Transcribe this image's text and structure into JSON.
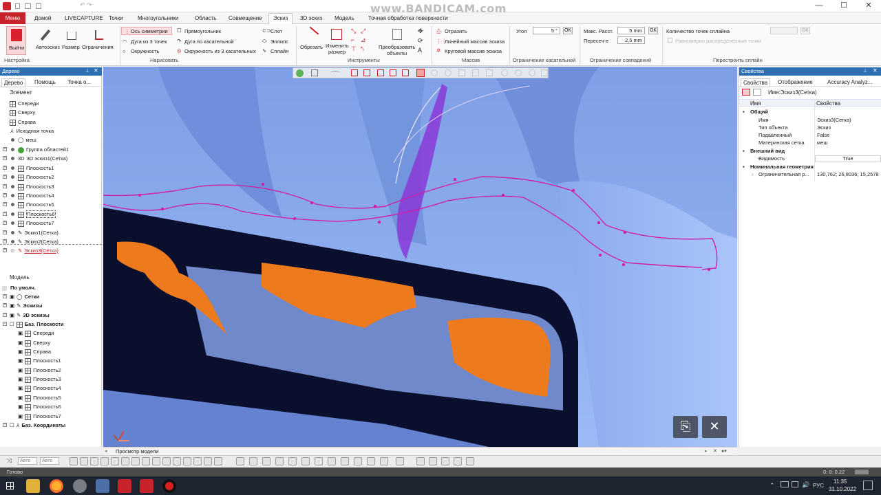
{
  "titlebar": {
    "minimize": "—",
    "maximize": "☐",
    "close": "✕"
  },
  "watermark": "www.BANDICAM.com",
  "menu": {
    "main_button": "Меню",
    "tabs": [
      "Домой",
      "LIVECAPTURE",
      "Точки",
      "Многоугольники",
      "Область",
      "Совмещение",
      "Эскиз",
      "3D эскиз",
      "Модель",
      "Точная обработка поверхности"
    ],
    "active_tab": "Эскиз"
  },
  "ribbon": {
    "exit_label": "Выйти",
    "autosketch": "Автоэскиз",
    "size": "Размер",
    "constraints": "Ограничения",
    "symmetry_axis": "Ось симметрии",
    "rectangle": "Прямоугольник",
    "slot": "Слот",
    "arc3": "Дуга из 3 точек",
    "arc_tangent": "Дуга по касательной",
    "ellipse": "Эллипс",
    "circle": "Окружность",
    "circle3tangent": "Окружность из 3 касательных",
    "spline": "Сплайн",
    "trim": "Обрезать",
    "resize1": "Изменить",
    "resize2": "размер",
    "transform1": "Преобразовать",
    "transform2": "объекты",
    "mirror": "Отразить",
    "linear_array": "Линейный массив эскиза",
    "circular_array": "Круговой массив эскиза",
    "angle_label": "Угол",
    "angle_value": "5 °",
    "ok": "OK",
    "max_dist_label": "Макс. Расст.",
    "max_dist_value": "5 mm",
    "intersect_label": "Пересеч-е",
    "intersect_value": "2,5 mm",
    "spline_points_label": "Количество точек сплайна",
    "evenly_label": "Равномерно распределенные точки",
    "groups": [
      "Настройка",
      "Нарисовать",
      "Инструменты",
      "Массив",
      "Ограничение касательной",
      "Ограничение совпадений",
      "Перестроить сплайн"
    ]
  },
  "tree_panel": {
    "title": "Дерево",
    "tabs": [
      "Дерево",
      "Помощь",
      "Точка о..."
    ],
    "element_header": "Элемент",
    "items": [
      "Спереди",
      "Сверху",
      "Справа",
      "Исходная точка",
      "меш",
      "Группа областей1",
      "3D эскиз1(Сетка)",
      "Плоскость1",
      "Плоскость2",
      "Плоскость3",
      "Плоскость4",
      "Плоскость5",
      "Плоскость6",
      "Плоскость7",
      "Эскиз1(Сетка)",
      "Эскиз2(Сетка)",
      "Эскиз3(Сетка)"
    ],
    "model_header": "Модель",
    "model_items": [
      "По умолч.",
      "Сетки",
      "Эскизы",
      "3D эскизы",
      "Баз. Плоскости",
      "Спереди",
      "Сверху",
      "Справа",
      "Плоскость1",
      "Плоскость2",
      "Плоскость3",
      "Плоскость4",
      "Плоскость5",
      "Плоскость6",
      "Плоскость7",
      "Баз. Координаты"
    ]
  },
  "properties": {
    "title": "Свойства",
    "tabs": [
      "Свойства",
      "Отображение",
      "Accuracy Analyz..."
    ],
    "name_line": "Имя:Эскиз3(Сетка)",
    "col_name": "Имя",
    "col_props": "Свойства",
    "rows": [
      {
        "name": "Общий",
        "value": "",
        "group": true
      },
      {
        "name": "Имя",
        "value": "Эскиз3(Сетка)",
        "group": false
      },
      {
        "name": "Тип объекта",
        "value": "Эскиз",
        "group": false
      },
      {
        "name": "Подавленный",
        "value": "False",
        "group": false
      },
      {
        "name": "Материнская сетка",
        "value": "меш",
        "group": false
      },
      {
        "name": "Внешний вид",
        "value": "",
        "group": true
      },
      {
        "name": "Видимость",
        "value": "True",
        "group": false
      },
      {
        "name": "Номинальная геометрия",
        "value": "",
        "group": true
      },
      {
        "name": "Ограничительная р...",
        "value": "130,762; 26,8036; 15,2578",
        "group": false
      }
    ]
  },
  "viewport": {
    "view_tab": "Просмотр модели"
  },
  "bottom": {
    "auto1": "Авто",
    "auto2": "Авто"
  },
  "status": {
    "text": "Готово",
    "timer": "0: 0: 0.22"
  },
  "taskbar": {
    "time": "11:35",
    "date": "31.10.2022",
    "lang": "РУС"
  },
  "colors": {
    "accent": "#c8232b",
    "mesh": "#8fb1f3",
    "sketch": "#d21ea5",
    "orange": "#ee7a1e",
    "selection": "#8a3ad8"
  }
}
